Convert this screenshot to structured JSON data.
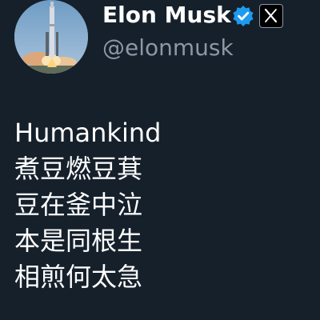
{
  "author": {
    "display_name": "Elon Musk",
    "handle": "@elonmusk",
    "avatar_icon": "rocket-launch-avatar",
    "verified_icon": "verified-badge-icon",
    "affiliation_icon": "x-logo-icon",
    "verified_color": "#1d9bf0"
  },
  "post": {
    "lines": [
      "Humankind",
      "煮豆燃豆萁",
      "豆在釜中泣",
      "本是同根生",
      "相煎何太急"
    ]
  },
  "colors": {
    "background": "#15202b",
    "text_primary": "#ffffff",
    "text_secondary": "#8b98a5"
  }
}
